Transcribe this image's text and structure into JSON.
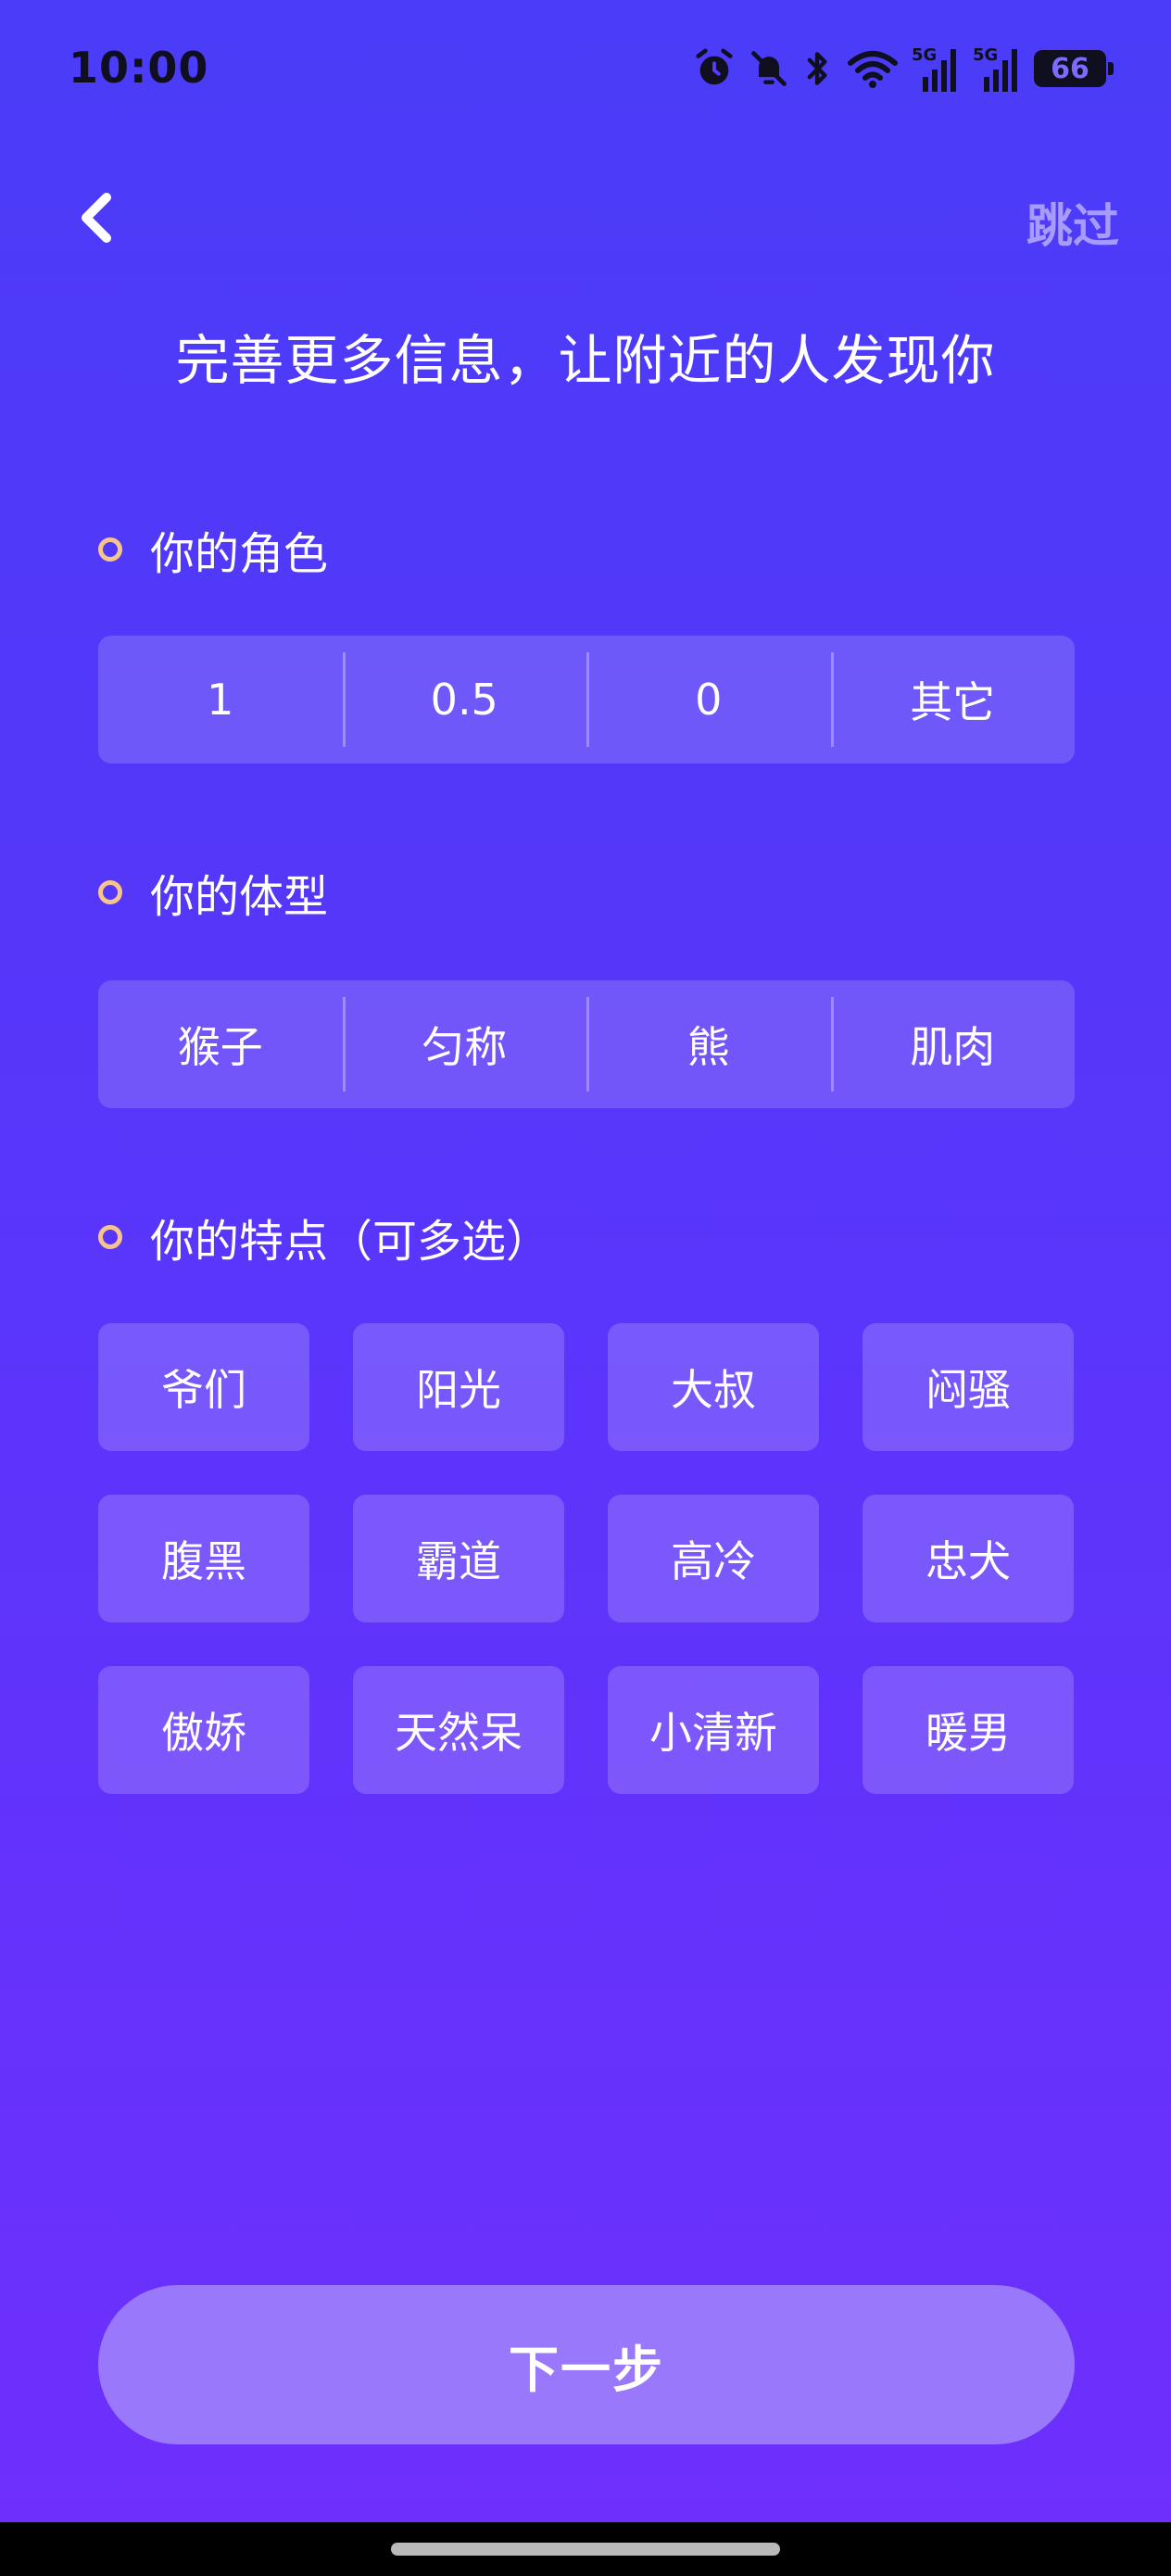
{
  "status_bar": {
    "time": "10:00",
    "network_1": "5G",
    "network_2": "5G",
    "battery_level": "66",
    "icons": [
      "alarm-icon",
      "bell-off-icon",
      "bluetooth-icon",
      "wifi-icon",
      "signal-icon",
      "signal-icon",
      "battery-icon"
    ]
  },
  "header": {
    "back_icon": "chevron-left-icon",
    "skip_label": "跳过",
    "title": "完善更多信息，让附近的人发现你"
  },
  "role_section": {
    "heading": "你的角色",
    "options": [
      "1",
      "0.5",
      "0",
      "其它"
    ]
  },
  "body_section": {
    "heading": "你的体型",
    "options": [
      "猴子",
      "匀称",
      "熊",
      "肌肉"
    ]
  },
  "traits_section": {
    "heading": "你的特点（可多选）",
    "tags": [
      "爷们",
      "阳光",
      "大叔",
      "闷骚",
      "腹黑",
      "霸道",
      "高冷",
      "忠犬",
      "傲娇",
      "天然呆",
      "小清新",
      "暖男"
    ]
  },
  "footer": {
    "next_label": "下一步"
  },
  "colors": {
    "background_top": "#4a3cf8",
    "background_bottom": "#6f2ffc",
    "accent_dot": "#f6c58c",
    "skip_text": "#a79cfb",
    "next_button": "#9a78fb"
  }
}
